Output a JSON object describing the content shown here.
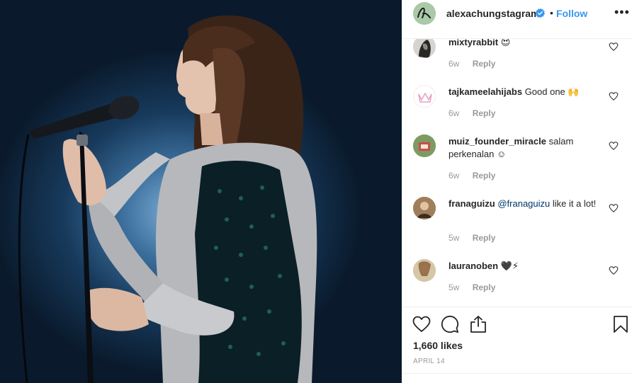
{
  "post": {
    "author": "alexachungstagram",
    "follow_label": "Follow",
    "separator": "•",
    "more_label": "•••",
    "likes": "1,660 likes",
    "date": "APRIL 14"
  },
  "comments": [
    {
      "user": "mixtyrabbit",
      "text": "😍",
      "mention": "",
      "text_after": "",
      "time": "6w",
      "reply": "Reply"
    },
    {
      "user": "tajkameelahijabs",
      "text": "Good one 🙌",
      "mention": "",
      "text_after": "",
      "time": "6w",
      "reply": "Reply"
    },
    {
      "user": "muiz_founder_miracle",
      "text": "salam perkenalan ☺",
      "mention": "",
      "text_after": "",
      "time": "6w",
      "reply": "Reply"
    },
    {
      "user": "franaguizu",
      "text": "",
      "mention": "@franaguizu",
      "text_after": " like it a lot!",
      "time": "5w",
      "reply": "Reply"
    },
    {
      "user": "lauranoben",
      "text": "🖤⚡",
      "mention": "",
      "text_after": "",
      "time": "5w",
      "reply": "Reply"
    }
  ],
  "icons": {
    "verified": "verified-badge-icon",
    "heart": "heart-outline-icon",
    "comment": "comment-bubble-icon",
    "share": "share-upload-icon",
    "save": "bookmark-icon",
    "more": "more-horizontal-icon"
  },
  "colors": {
    "link_blue": "#3897f0",
    "mention_blue": "#003569",
    "muted": "#999999",
    "text": "#262626",
    "divider": "#efefef"
  }
}
